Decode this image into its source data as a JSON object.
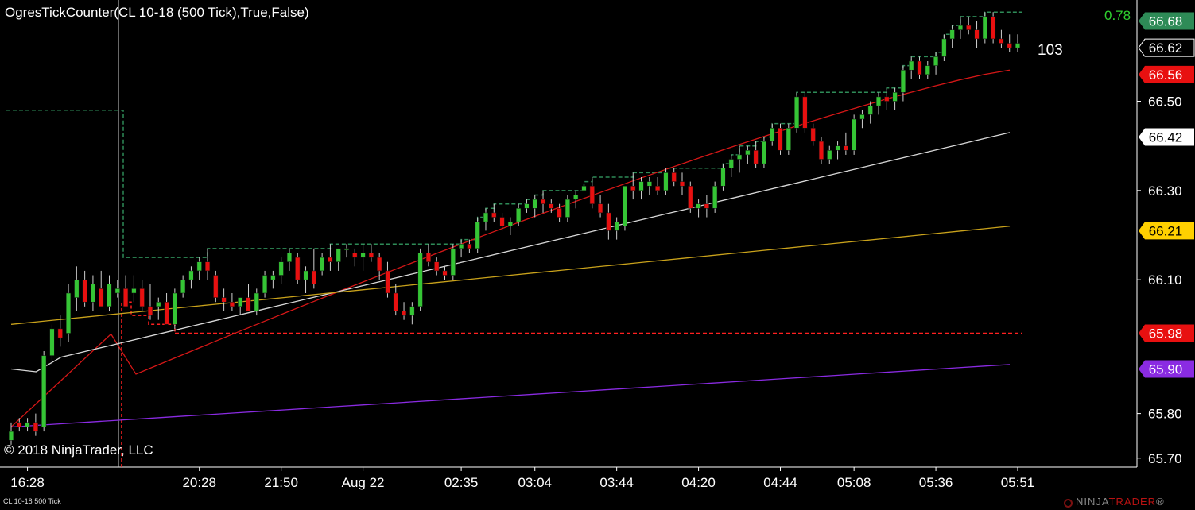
{
  "header": {
    "indicator_title": "OgresTickCounter(CL 10-18 (500 Tick),True,False)",
    "top_value": "0.78",
    "tick_counter": "103"
  },
  "footer": {
    "copyright": "© 2018 NinjaTrader, LLC",
    "instrument_label": "CL 10-18 500 Tick",
    "brand_prefix": "NINJA",
    "brand_suffix": "TRADER",
    "brand_reg": "®"
  },
  "colors": {
    "background": "#000000",
    "up_candle": "#35c535",
    "down_candle": "#e81010",
    "sma_red": "#d51717",
    "sma_white": "#d8d8d8",
    "sma_gold": "#c9a21b",
    "sma_purple": "#8a2be2",
    "tick_step": "#2e8b57",
    "reference": "#ff2020",
    "axis": "#ffffff",
    "grid_text": "#ffffff"
  },
  "chart_data": {
    "type": "candlestick",
    "instrument": "CL 10-18 (500 Tick)",
    "ylim": [
      65.68,
      66.72
    ],
    "y_ticks": [
      "65.70",
      "65.80",
      "66.10",
      "66.30",
      "66.50"
    ],
    "x_ticks": [
      {
        "label": "16:28",
        "bar": 1
      },
      {
        "label": "20:28",
        "bar": 12
      },
      {
        "label": "21:50",
        "bar": 17
      },
      {
        "label": "Aug 22",
        "bar": 22
      },
      {
        "label": "02:35",
        "bar": 28
      },
      {
        "label": "03:04",
        "bar": 33
      },
      {
        "label": "03:44",
        "bar": 38
      },
      {
        "label": "04:20",
        "bar": 43
      },
      {
        "label": "04:44",
        "bar": 48
      },
      {
        "label": "05:08",
        "bar": 53
      },
      {
        "label": "05:36",
        "bar": 58
      },
      {
        "label": "05:51",
        "bar": 63
      }
    ],
    "bar_spacing_note": "bars are evenly spaced tick bars",
    "candles": [
      [
        65.74,
        65.78,
        65.73,
        65.76
      ],
      [
        65.78,
        65.79,
        65.76,
        65.77
      ],
      [
        65.77,
        65.79,
        65.76,
        65.78
      ],
      [
        65.78,
        65.8,
        65.75,
        65.76
      ],
      [
        65.77,
        65.94,
        65.76,
        65.93
      ],
      [
        65.93,
        66.0,
        65.91,
        65.99
      ],
      [
        65.99,
        66.02,
        65.95,
        65.97
      ],
      [
        65.98,
        66.09,
        65.96,
        66.07
      ],
      [
        66.06,
        66.13,
        66.03,
        66.1
      ],
      [
        66.1,
        66.12,
        66.04,
        66.05
      ],
      [
        66.05,
        66.11,
        66.03,
        66.09
      ],
      [
        66.08,
        66.12,
        66.04,
        66.04
      ],
      [
        66.04,
        66.11,
        66.03,
        66.09
      ],
      [
        66.07,
        66.1,
        66.06,
        66.08
      ],
      [
        66.08,
        66.11,
        66.04,
        66.04
      ],
      [
        66.07,
        66.11,
        66.05,
        66.08
      ],
      [
        66.08,
        66.1,
        66.03,
        66.04
      ],
      [
        66.04,
        66.09,
        66.01,
        66.02
      ],
      [
        66.04,
        66.06,
        66.01,
        66.05
      ],
      [
        66.05,
        66.07,
        66.0,
        66.0
      ],
      [
        66.0,
        66.08,
        65.99,
        66.07
      ],
      [
        66.07,
        66.11,
        66.06,
        66.1
      ],
      [
        66.1,
        66.13,
        66.08,
        66.12
      ],
      [
        66.12,
        66.15,
        66.1,
        66.14
      ],
      [
        66.14,
        66.17,
        66.1,
        66.12
      ],
      [
        66.11,
        66.12,
        66.05,
        66.06
      ],
      [
        66.06,
        66.08,
        66.03,
        66.05
      ],
      [
        66.05,
        66.07,
        66.03,
        66.04
      ],
      [
        66.04,
        66.06,
        66.02,
        66.06
      ],
      [
        66.06,
        66.09,
        66.03,
        66.03
      ],
      [
        66.03,
        66.08,
        66.02,
        66.07
      ],
      [
        66.07,
        66.12,
        66.06,
        66.11
      ],
      [
        66.1,
        66.12,
        66.08,
        66.11
      ],
      [
        66.11,
        66.15,
        66.09,
        66.14
      ],
      [
        66.14,
        66.17,
        66.12,
        66.16
      ],
      [
        66.15,
        66.16,
        66.09,
        66.1
      ],
      [
        66.1,
        66.13,
        66.07,
        66.12
      ],
      [
        66.12,
        66.17,
        66.08,
        66.09
      ],
      [
        66.12,
        66.16,
        66.11,
        66.15
      ],
      [
        66.15,
        66.18,
        66.12,
        66.14
      ],
      [
        66.14,
        66.17,
        66.12,
        66.17
      ],
      [
        66.17,
        66.18,
        66.15,
        66.17
      ],
      [
        66.16,
        66.17,
        66.13,
        66.15
      ],
      [
        66.15,
        66.18,
        66.12,
        66.16
      ],
      [
        66.16,
        66.18,
        66.14,
        66.15
      ],
      [
        66.15,
        66.16,
        66.1,
        66.12
      ],
      [
        66.12,
        66.14,
        66.06,
        66.07
      ],
      [
        66.07,
        66.09,
        66.02,
        66.03
      ],
      [
        66.03,
        66.05,
        66.01,
        66.02
      ],
      [
        66.02,
        66.05,
        66.0,
        66.04
      ],
      [
        66.04,
        66.17,
        66.03,
        66.16
      ],
      [
        66.16,
        66.18,
        66.13,
        66.14
      ],
      [
        66.14,
        66.15,
        66.11,
        66.12
      ],
      [
        66.12,
        66.13,
        66.1,
        66.11
      ],
      [
        66.11,
        66.18,
        66.1,
        66.17
      ],
      [
        66.17,
        66.19,
        66.15,
        66.18
      ],
      [
        66.18,
        66.19,
        66.16,
        66.17
      ],
      [
        66.17,
        66.24,
        66.16,
        66.23
      ],
      [
        66.23,
        66.26,
        66.21,
        66.25
      ],
      [
        66.25,
        66.27,
        66.23,
        66.24
      ],
      [
        66.24,
        66.25,
        66.21,
        66.22
      ],
      [
        66.22,
        66.24,
        66.2,
        66.23
      ],
      [
        66.23,
        66.27,
        66.22,
        66.26
      ],
      [
        66.26,
        66.28,
        66.25,
        66.27
      ],
      [
        66.26,
        66.29,
        66.24,
        66.28
      ],
      [
        66.28,
        66.3,
        66.25,
        66.27
      ],
      [
        66.27,
        66.28,
        66.25,
        66.26
      ],
      [
        66.26,
        66.27,
        66.23,
        66.24
      ],
      [
        66.24,
        66.29,
        66.23,
        66.28
      ],
      [
        66.28,
        66.3,
        66.26,
        66.29
      ],
      [
        66.3,
        66.32,
        66.27,
        66.31
      ],
      [
        66.31,
        66.33,
        66.26,
        66.27
      ],
      [
        66.27,
        66.29,
        66.24,
        66.25
      ],
      [
        66.25,
        66.27,
        66.19,
        66.21
      ],
      [
        66.21,
        66.24,
        66.19,
        66.23
      ],
      [
        66.22,
        66.31,
        66.21,
        66.31
      ],
      [
        66.31,
        66.34,
        66.28,
        66.3
      ],
      [
        66.3,
        66.33,
        66.28,
        66.32
      ],
      [
        66.31,
        66.33,
        66.29,
        66.32
      ],
      [
        66.31,
        66.33,
        66.29,
        66.3
      ],
      [
        66.3,
        66.35,
        66.29,
        66.34
      ],
      [
        66.34,
        66.35,
        66.31,
        66.32
      ],
      [
        66.32,
        66.34,
        66.29,
        66.31
      ],
      [
        66.31,
        66.32,
        66.25,
        66.26
      ],
      [
        66.26,
        66.28,
        66.24,
        66.27
      ],
      [
        66.27,
        66.29,
        66.24,
        66.26
      ],
      [
        66.26,
        66.32,
        66.25,
        66.31
      ],
      [
        66.31,
        66.36,
        66.3,
        66.35
      ],
      [
        66.35,
        66.38,
        66.33,
        66.37
      ],
      [
        66.37,
        66.4,
        66.34,
        66.38
      ],
      [
        66.38,
        66.4,
        66.36,
        66.39
      ],
      [
        66.39,
        66.41,
        66.35,
        66.36
      ],
      [
        66.36,
        66.42,
        66.35,
        66.41
      ],
      [
        66.41,
        66.45,
        66.4,
        66.44
      ],
      [
        66.44,
        66.45,
        66.38,
        66.39
      ],
      [
        66.39,
        66.45,
        66.38,
        66.44
      ],
      [
        66.44,
        66.52,
        66.43,
        66.51
      ],
      [
        66.51,
        66.52,
        66.43,
        66.44
      ],
      [
        66.44,
        66.45,
        66.4,
        66.41
      ],
      [
        66.41,
        66.42,
        66.36,
        66.37
      ],
      [
        66.37,
        66.4,
        66.36,
        66.39
      ],
      [
        66.39,
        66.41,
        66.37,
        66.4
      ],
      [
        66.4,
        66.43,
        66.38,
        66.39
      ],
      [
        66.39,
        66.47,
        66.38,
        66.46
      ],
      [
        66.46,
        66.48,
        66.44,
        66.47
      ],
      [
        66.47,
        66.5,
        66.45,
        66.49
      ],
      [
        66.49,
        66.52,
        66.47,
        66.51
      ],
      [
        66.51,
        66.53,
        66.48,
        66.5
      ],
      [
        66.5,
        66.53,
        66.48,
        66.52
      ],
      [
        66.52,
        66.58,
        66.5,
        66.57
      ],
      [
        66.57,
        66.6,
        66.55,
        66.59
      ],
      [
        66.59,
        66.6,
        66.55,
        66.56
      ],
      [
        66.56,
        66.59,
        66.55,
        66.58
      ],
      [
        66.58,
        66.61,
        66.56,
        66.6
      ],
      [
        66.6,
        66.65,
        66.59,
        66.64
      ],
      [
        66.64,
        66.67,
        66.62,
        66.66
      ],
      [
        66.66,
        66.69,
        66.64,
        66.67
      ],
      [
        66.67,
        66.69,
        66.65,
        66.66
      ],
      [
        66.66,
        66.68,
        66.62,
        66.64
      ],
      [
        66.64,
        66.7,
        66.63,
        66.69
      ],
      [
        66.69,
        66.7,
        66.63,
        66.64
      ],
      [
        66.64,
        66.66,
        66.62,
        66.63
      ],
      [
        66.63,
        66.65,
        66.61,
        66.62
      ],
      [
        66.62,
        66.65,
        66.61,
        66.63
      ]
    ],
    "moving_averages": [
      {
        "color_key": "sma_red",
        "start": 65.77,
        "end": 66.57
      },
      {
        "color_key": "sma_white",
        "start": 65.9,
        "end": 66.43
      },
      {
        "color_key": "sma_gold",
        "start": 66.0,
        "end": 66.22
      },
      {
        "color_key": "sma_purple",
        "start": 65.77,
        "end": 65.91
      }
    ],
    "reference_levels": [
      {
        "color_key": "reference",
        "value": 65.98,
        "style": "dashed"
      }
    ],
    "price_markers": [
      {
        "label": "66.68",
        "value": 66.68,
        "bg": "#2e8b57",
        "fg": "#ffffff"
      },
      {
        "label": "66.62",
        "value": 66.62,
        "bg": "#000000",
        "fg": "#ffffff",
        "outline": "#ffffff"
      },
      {
        "label": "66.56",
        "value": 66.56,
        "bg": "#e81010",
        "fg": "#ffffff"
      },
      {
        "label": "66.42",
        "value": 66.42,
        "bg": "#ffffff",
        "fg": "#000000"
      },
      {
        "label": "66.21",
        "value": 66.21,
        "bg": "#ffd000",
        "fg": "#000000"
      },
      {
        "label": "65.98",
        "value": 65.98,
        "bg": "#e81010",
        "fg": "#ffffff"
      },
      {
        "label": "65.90",
        "value": 65.9,
        "bg": "#8a2be2",
        "fg": "#ffffff"
      }
    ]
  }
}
